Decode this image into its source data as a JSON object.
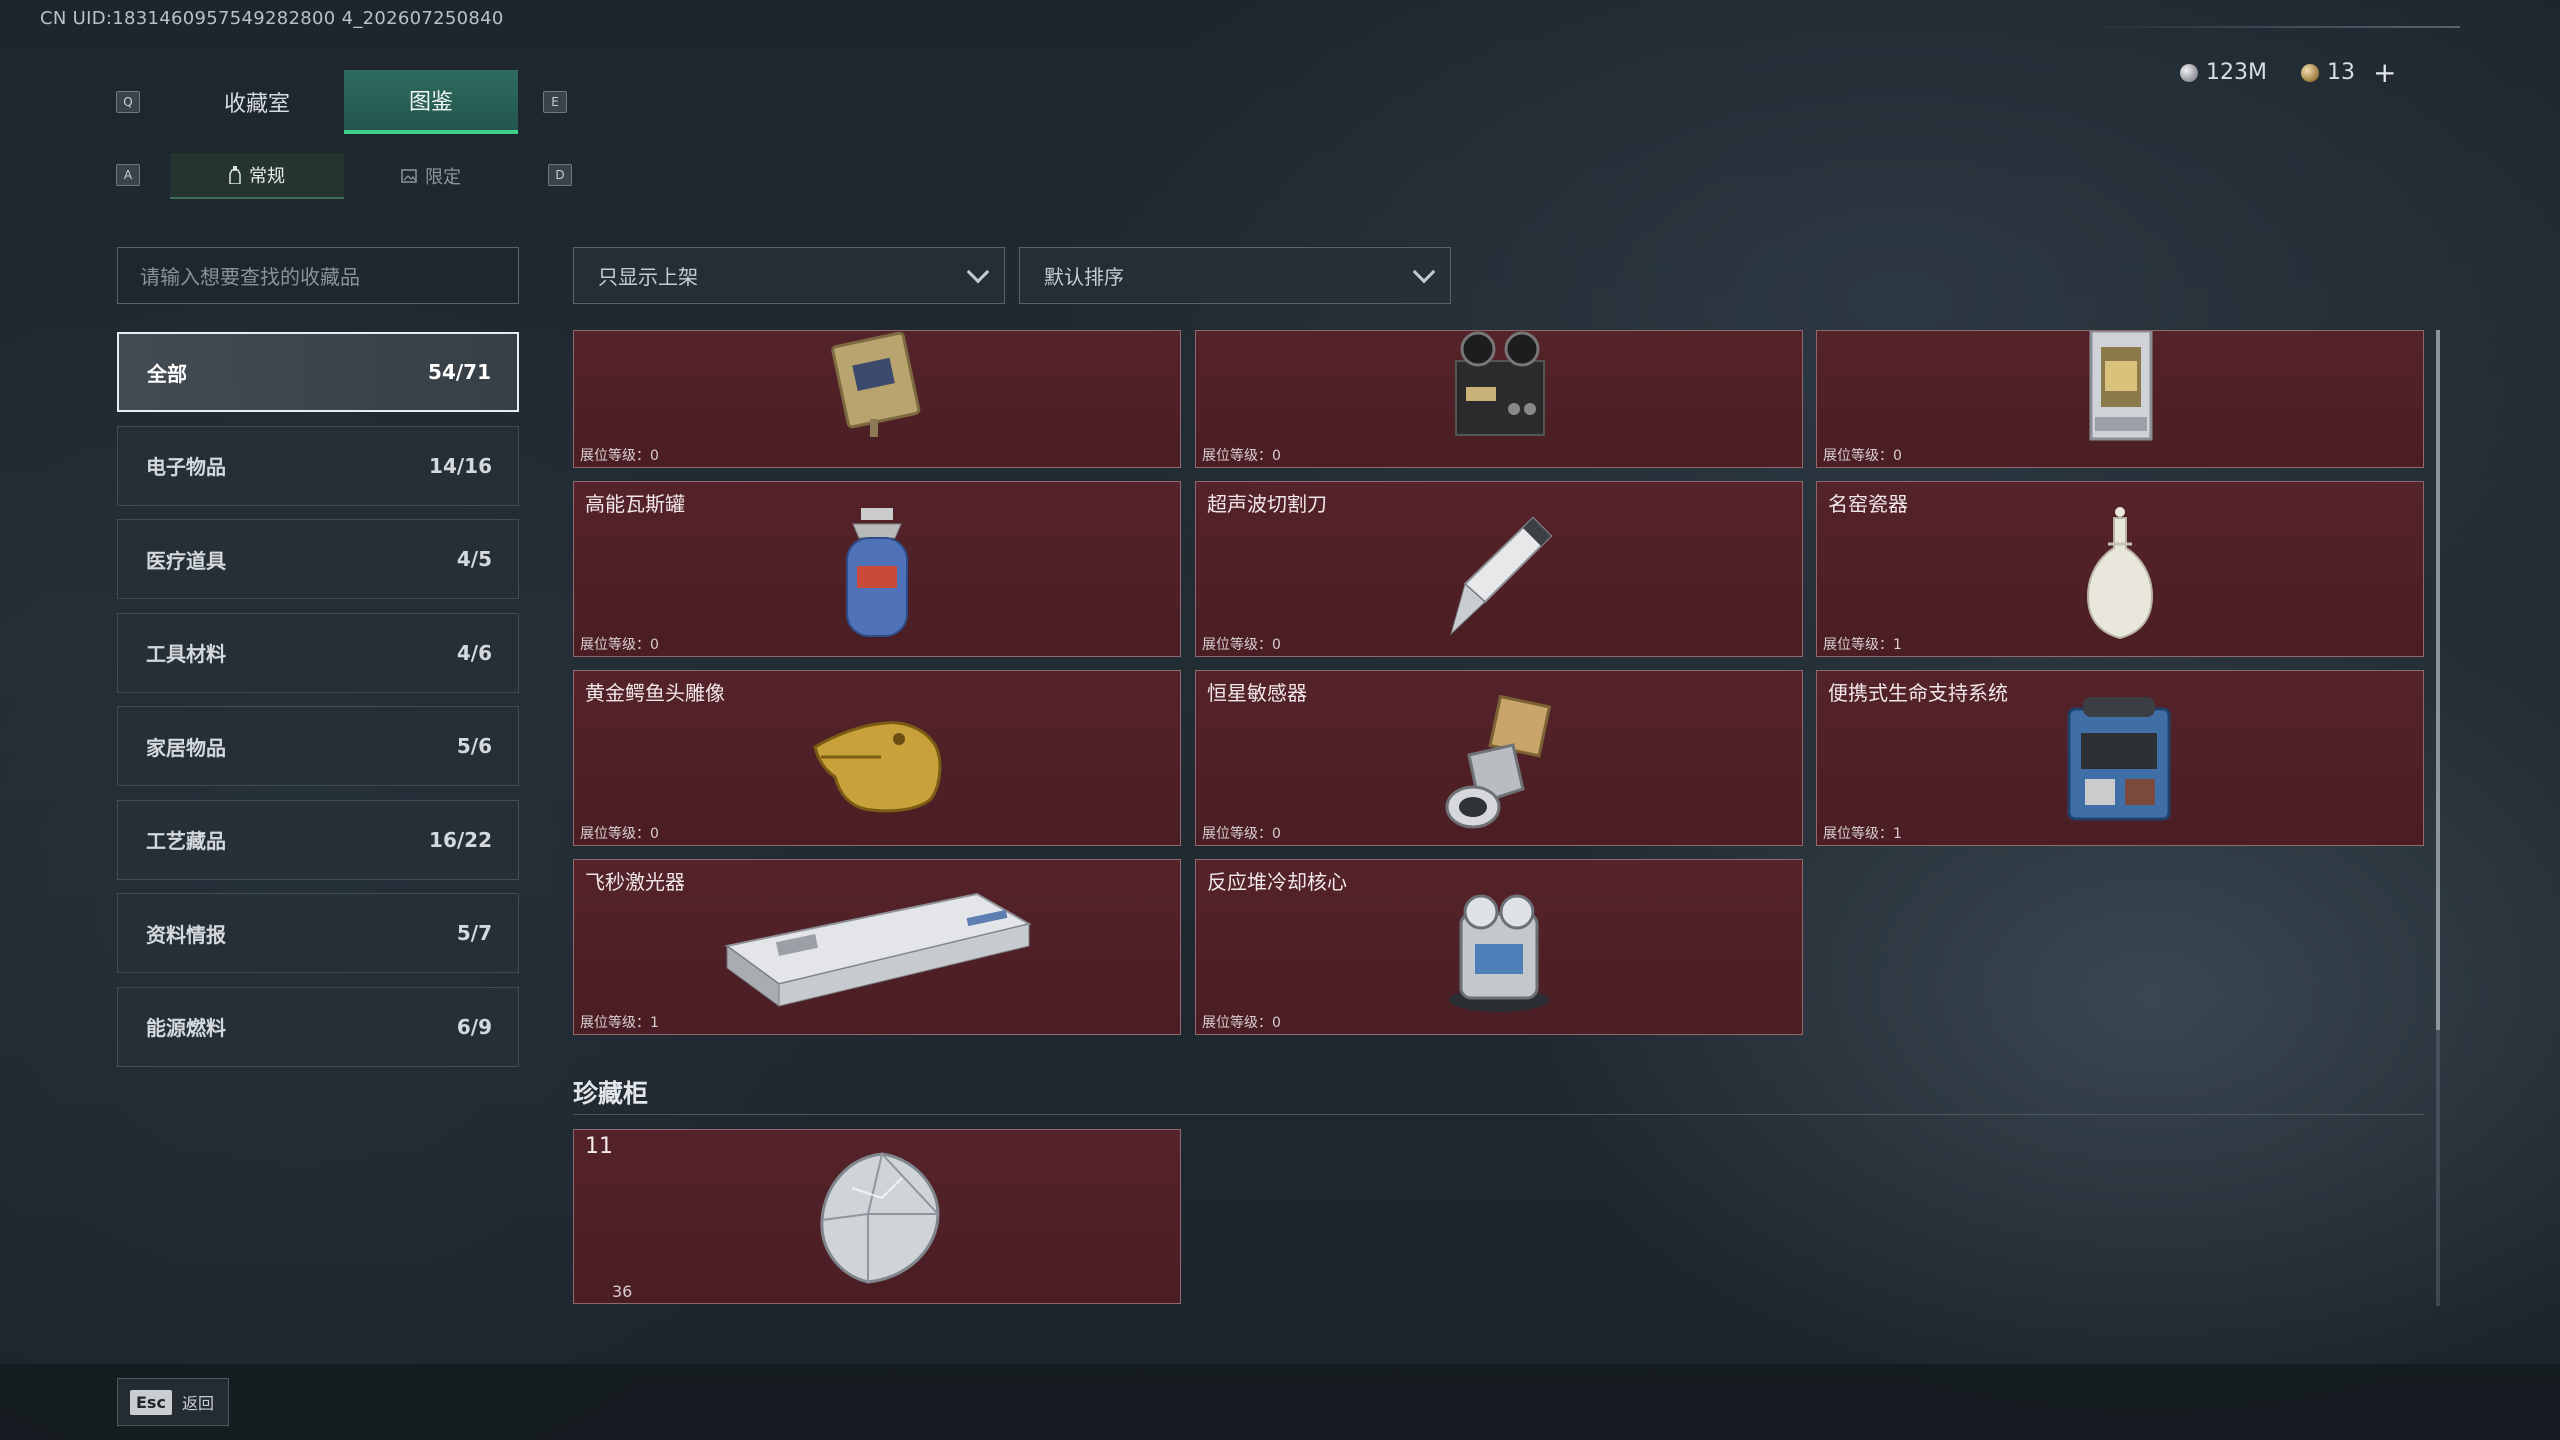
{
  "uid_text": "CN UID:1831460957549282800 4_202607250840",
  "currency": {
    "silver": "123M",
    "gold": "13",
    "add": "+"
  },
  "keys": {
    "q": "Q",
    "e": "E",
    "a": "A",
    "d": "D"
  },
  "tabs": [
    "收藏室",
    "图鉴"
  ],
  "subtabs": [
    "常规",
    "限定"
  ],
  "search": {
    "placeholder": "请输入想要查找的收藏品"
  },
  "categories": [
    {
      "label": "全部",
      "count": "54/71"
    },
    {
      "label": "电子物品",
      "count": "14/16"
    },
    {
      "label": "医疗道具",
      "count": "4/5"
    },
    {
      "label": "工具材料",
      "count": "4/6"
    },
    {
      "label": "家居物品",
      "count": "5/6"
    },
    {
      "label": "工艺藏品",
      "count": "16/22"
    },
    {
      "label": "资料情报",
      "count": "5/7"
    },
    {
      "label": "能源燃料",
      "count": "6/9"
    }
  ],
  "filters": {
    "shelf": "只显示上架",
    "sort": "默认排序"
  },
  "items": [
    {
      "name": "",
      "level": "展位等级：0",
      "icon": "signal-device-icon"
    },
    {
      "name": "",
      "level": "展位等级：0",
      "icon": "reel-recorder-icon"
    },
    {
      "name": "",
      "level": "展位等级：0",
      "icon": "lantern-device-icon"
    },
    {
      "name": "高能瓦斯罐",
      "level": "展位等级：0",
      "icon": "gas-canister-icon"
    },
    {
      "name": "超声波切割刀",
      "level": "展位等级：0",
      "icon": "ultrasonic-cutter-icon"
    },
    {
      "name": "名窑瓷器",
      "level": "展位等级：1",
      "icon": "porcelain-vase-icon"
    },
    {
      "name": "黄金鳄鱼头雕像",
      "level": "展位等级：0",
      "icon": "gold-crocodile-icon"
    },
    {
      "name": "恒星敏感器",
      "level": "展位等级：0",
      "icon": "star-sensor-icon"
    },
    {
      "name": "便携式生命支持系统",
      "level": "展位等级：1",
      "icon": "life-support-icon"
    },
    {
      "name": "飞秒激光器",
      "level": "展位等级：1",
      "icon": "femto-laser-icon"
    },
    {
      "name": "反应堆冷却核心",
      "level": "展位等级：0",
      "icon": "reactor-core-icon"
    }
  ],
  "section": {
    "title": "珍藏柜"
  },
  "gem": {
    "num": "11",
    "sub": "36",
    "icon": "diamond-icon"
  },
  "footer": {
    "esc_key": "Esc",
    "esc_label": "返回"
  }
}
